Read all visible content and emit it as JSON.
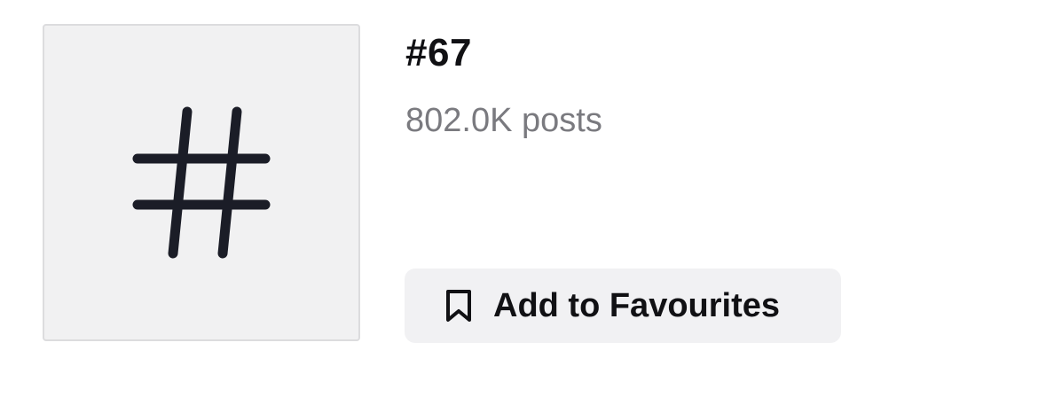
{
  "hashtag": {
    "tile_icon": "hashtag-icon",
    "title": "#67",
    "post_count": "802.0K posts"
  },
  "actions": {
    "favourite_icon": "bookmark-icon",
    "favourite_label": "Add to Favourites"
  },
  "colors": {
    "tile_background": "#f1f1f2",
    "button_background": "#f1f1f3",
    "title_text": "#111114",
    "secondary_text": "#7a7a7f"
  }
}
